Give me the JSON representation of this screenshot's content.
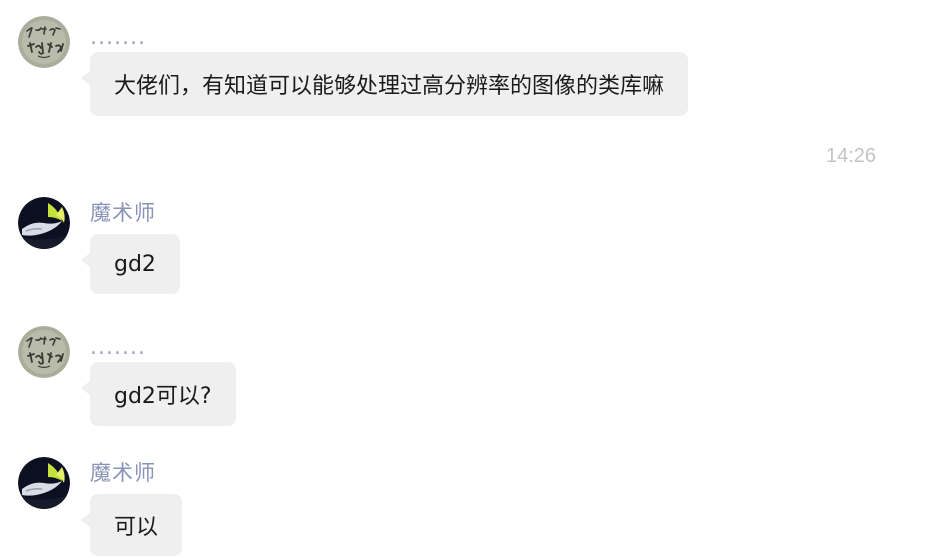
{
  "messages": [
    {
      "sender": ".......",
      "text": "大佬们，有知道可以能够处理过高分辨率的图像的类库嘛",
      "avatar": "calligraphy-avatar"
    },
    {
      "sender": "魔术师",
      "text": "gd2",
      "avatar": "magic-hand-avatar"
    },
    {
      "sender": ".......",
      "text": "gd2可以?",
      "avatar": "calligraphy-avatar"
    },
    {
      "sender": "魔术师",
      "text": "可以",
      "avatar": "magic-hand-avatar"
    }
  ],
  "timestamp": "14:26",
  "colors": {
    "bubble": "#efefef",
    "sender_name": "#8a93b8",
    "timestamp": "#c4c4c4"
  }
}
